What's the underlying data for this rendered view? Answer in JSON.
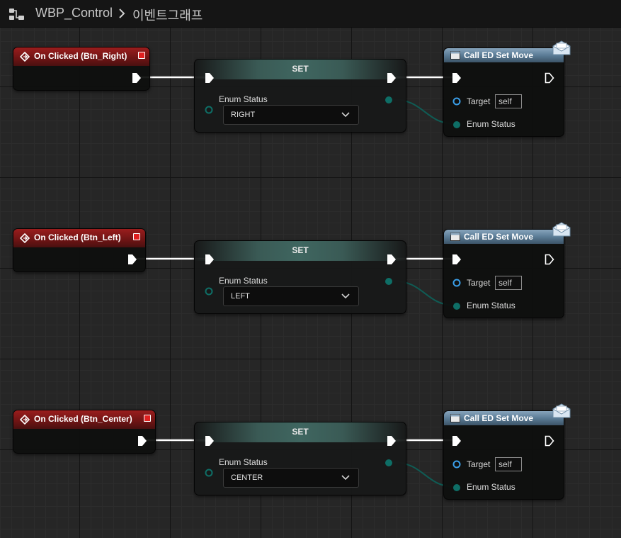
{
  "breadcrumb": {
    "icon": "blueprint-graph-icon",
    "blueprint_name": "WBP_Control",
    "separator_icon": "chevron-right-icon",
    "graph_name": "이벤트그래프"
  },
  "colors": {
    "event_header": "#9a1d1d",
    "set_header": "#3f6660",
    "call_header": "#5b7c96",
    "exec_wire": "#ffffff",
    "enum_wire": "#0f5c55",
    "enum_pin": "#0e6e66",
    "target_pin": "#3a9ee8"
  },
  "rows": [
    {
      "event_title": "On Clicked (Btn_Right)",
      "set_title": "SET",
      "set_label": "Enum Status",
      "enum_value": "RIGHT",
      "call_title": "Call ED Set Move",
      "target_label": "Target",
      "target_value": "self",
      "enum_label": "Enum Status"
    },
    {
      "event_title": "On Clicked (Btn_Left)",
      "set_title": "SET",
      "set_label": "Enum Status",
      "enum_value": "LEFT",
      "call_title": "Call ED Set Move",
      "target_label": "Target",
      "target_value": "self",
      "enum_label": "Enum Status"
    },
    {
      "event_title": "On Clicked (Btn_Center)",
      "set_title": "SET",
      "set_label": "Enum Status",
      "enum_value": "CENTER",
      "call_title": "Call ED Set Move",
      "target_label": "Target",
      "target_value": "self",
      "enum_label": "Enum Status"
    }
  ]
}
